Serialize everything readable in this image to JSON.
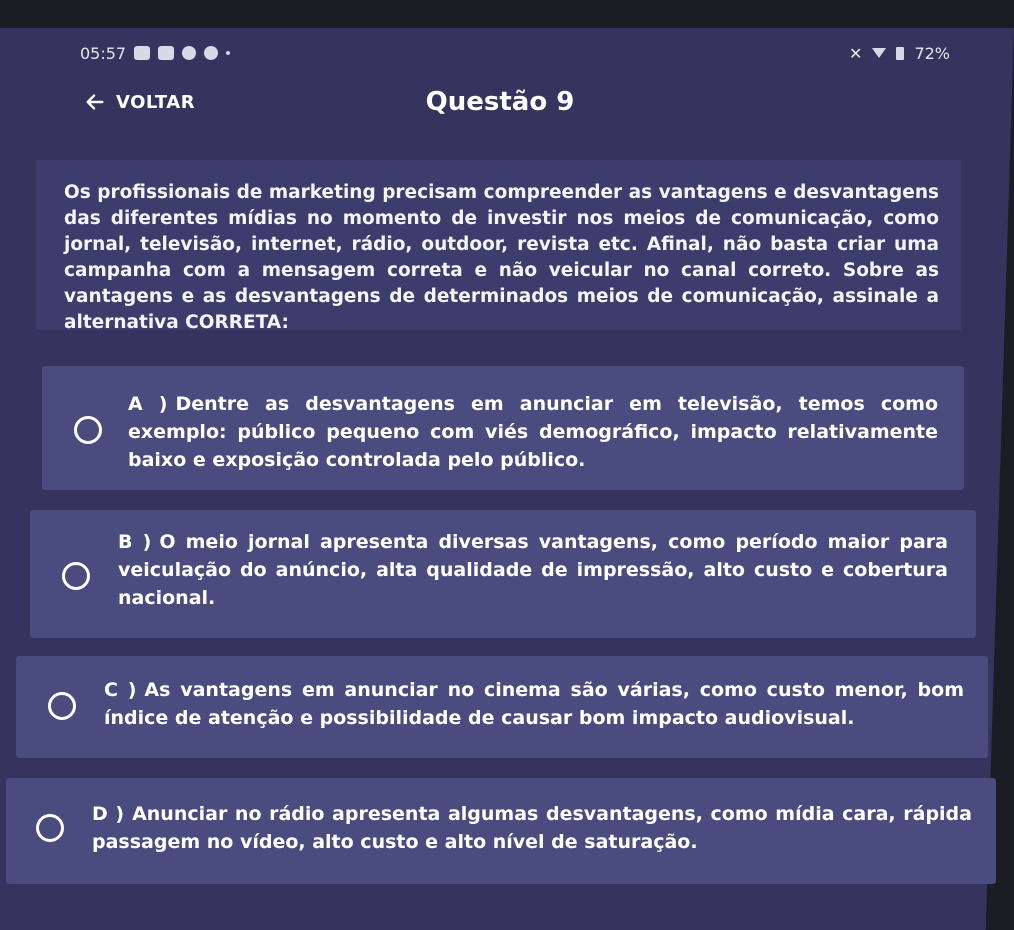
{
  "status": {
    "time": "05:57",
    "battery": "72%"
  },
  "header": {
    "back_label": "VOLTAR",
    "title": "Questão 9"
  },
  "question": {
    "prompt": "Os profissionais de marketing precisam compreender as vantagens e desvantagens das diferentes mídias no momento de investir nos meios de comunicação, como jornal, televisão, internet, rádio, outdoor, revista etc. Afinal, não basta criar uma campanha com a mensagem correta e não veicular no canal correto. Sobre as vantagens e as desvantagens de determinados meios de comunicação, assinale a alternativa CORRETA:"
  },
  "options": [
    {
      "letter": "A )",
      "text": "Dentre as desvantagens em anunciar em televisão, temos como exemplo: público pequeno com viés demográfico, impacto relativamente baixo e exposição controlada pelo público."
    },
    {
      "letter": "B )",
      "text": "O meio jornal apresenta diversas vantagens, como período maior para veiculação do anúncio, alta qualidade de impressão, alto custo e cobertura nacional."
    },
    {
      "letter": "C )",
      "text": "As vantagens em anunciar no cinema são várias, como custo menor, bom índice de atenção e possibilidade de causar bom impacto audiovisual."
    },
    {
      "letter": "D )",
      "text": "Anunciar no rádio apresenta algumas desvantagens, como mídia cara, rápida passagem no vídeo, alto custo e alto nível de saturação."
    }
  ],
  "colors": {
    "background": "#34345e",
    "card": "#4a4b7e",
    "text": "#ffffff"
  }
}
